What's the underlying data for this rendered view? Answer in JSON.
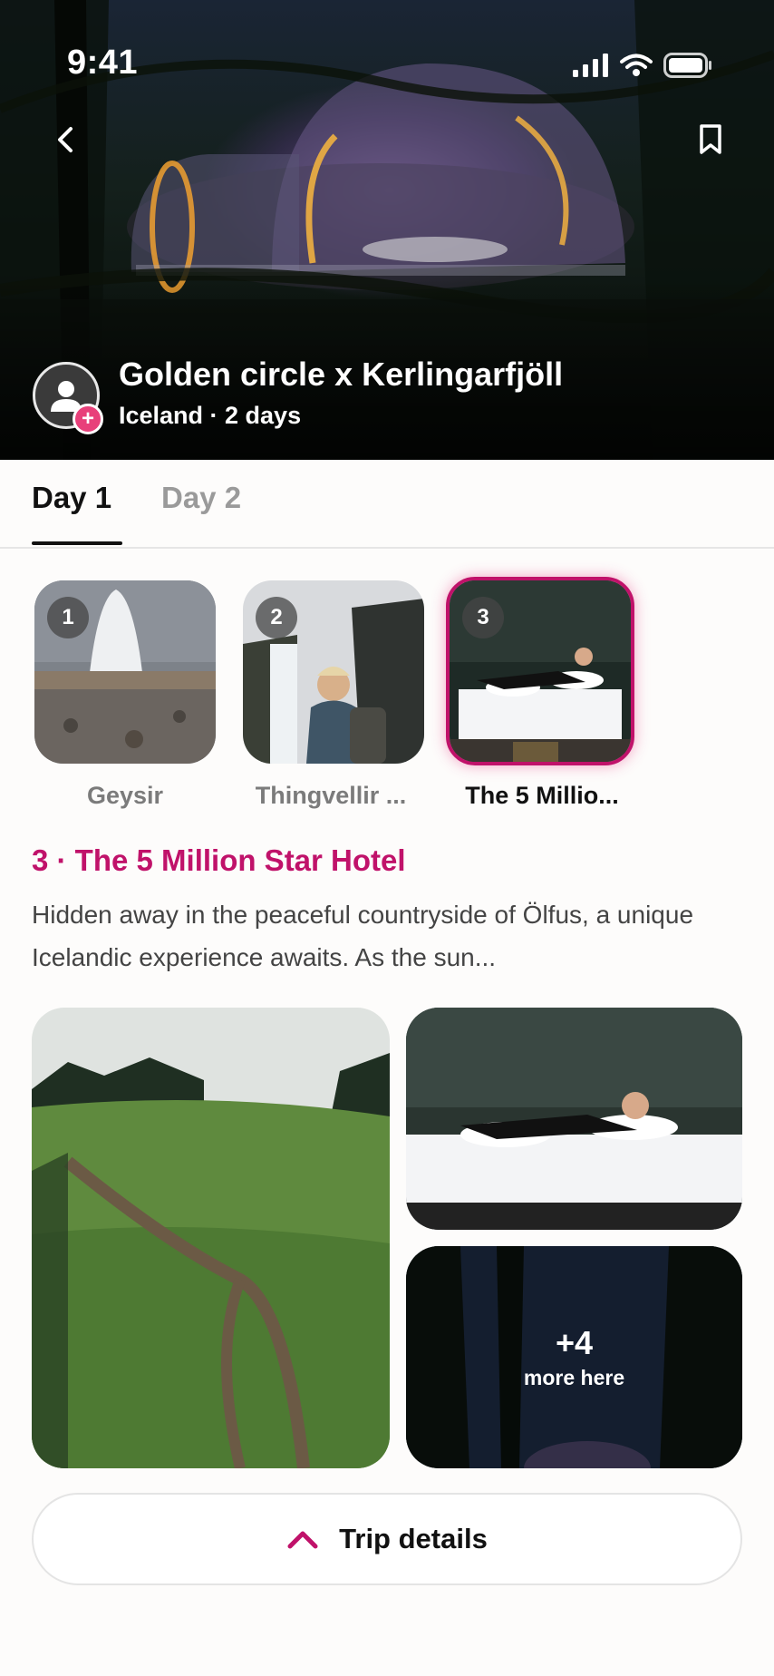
{
  "status_bar": {
    "time": "9:41"
  },
  "hero": {
    "title": "Golden circle x Kerlingarfjöll",
    "subtitle": "Iceland · 2 days"
  },
  "tabs": [
    {
      "label": "Day 1",
      "selected": true
    },
    {
      "label": "Day 2",
      "selected": false
    }
  ],
  "stops": [
    {
      "number": "1",
      "label": "Geysir"
    },
    {
      "number": "2",
      "label": "Thingvellir ..."
    },
    {
      "number": "3",
      "label": "The 5 Millio...",
      "selected": true
    }
  ],
  "detail": {
    "title": "3 · The 5 Million Star Hotel",
    "description": "Hidden away in the peaceful countryside of Ölfus, a unique Icelandic experience awaits. As the sun..."
  },
  "gallery": {
    "more_count": "+4",
    "more_text": "more here"
  },
  "footer": {
    "button_label": "Trip details"
  },
  "colors": {
    "accent": "#c0126a",
    "badge": "#e8407a"
  }
}
